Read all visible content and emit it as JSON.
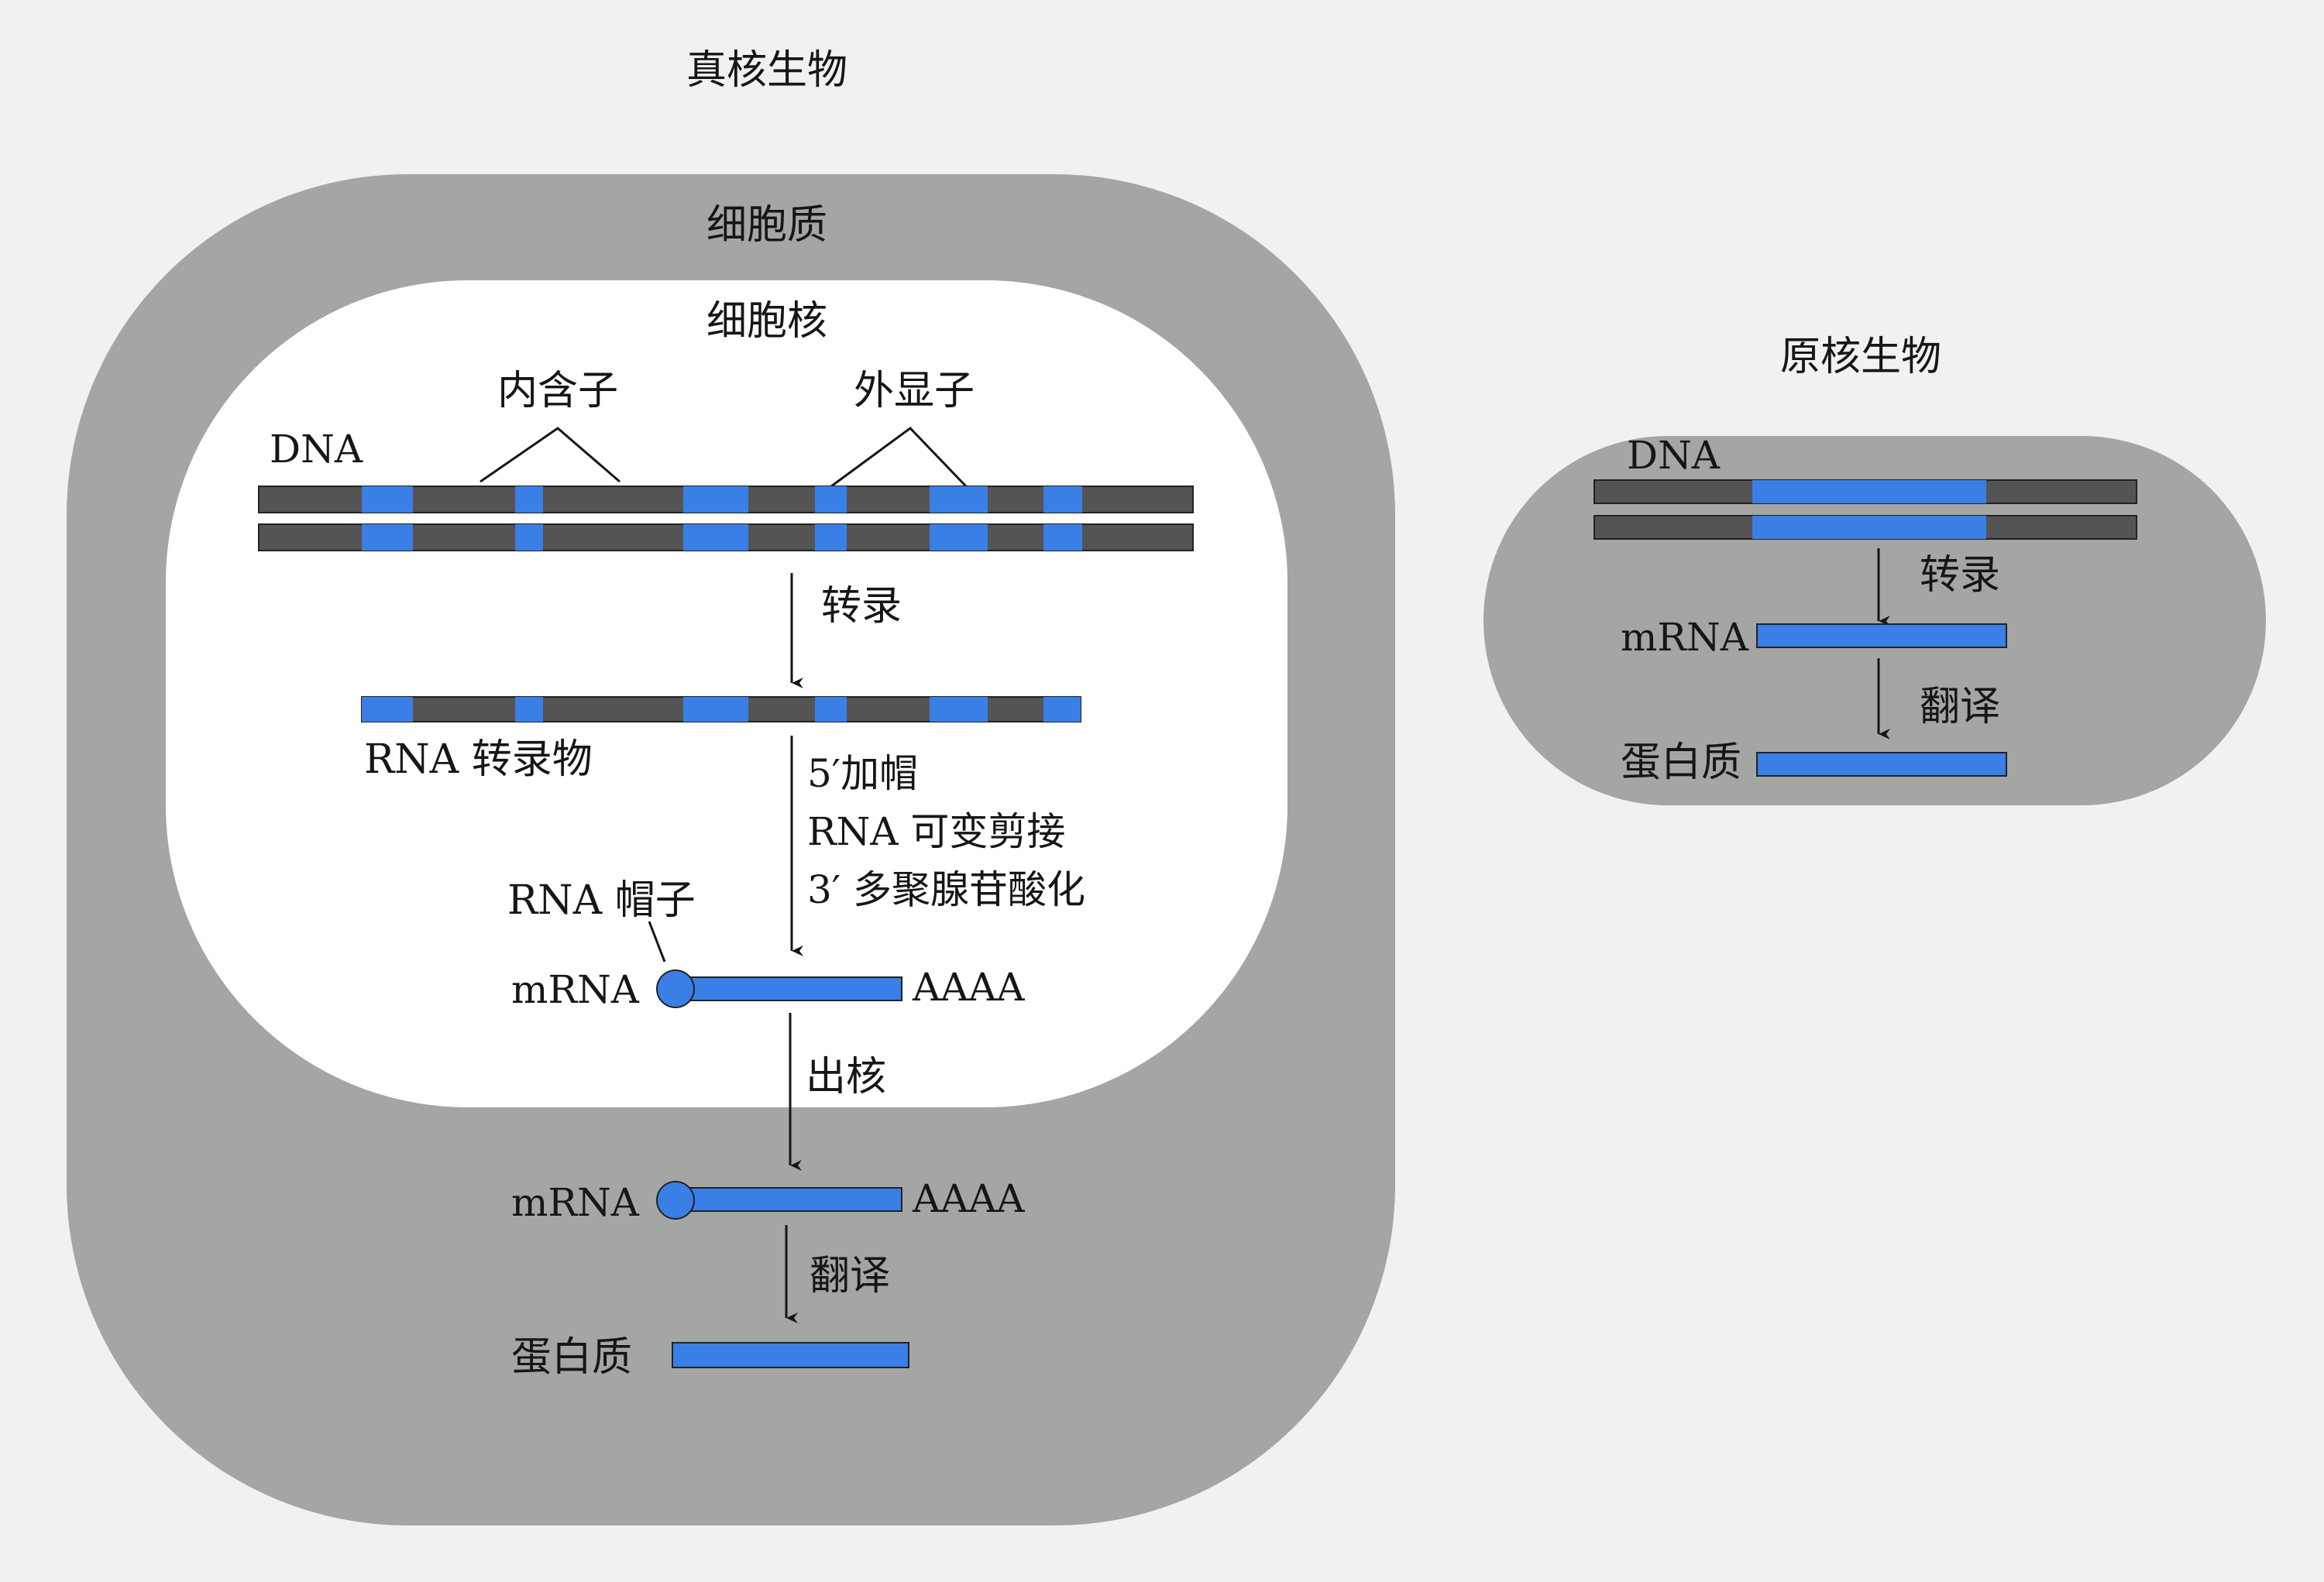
{
  "eukaryote": {
    "title": "真核生物",
    "cytoplasm_label": "细胞质",
    "nucleus_label": "细胞核",
    "intron_label": "内含子",
    "exon_label": "外显子",
    "dna_label": "DNA",
    "step_transcription": "转录",
    "rna_transcript_label": "RNA 转录物",
    "processing_steps": [
      "5′加帽",
      "RNA 可变剪接",
      "3′ 多聚腺苷酸化"
    ],
    "rna_cap_label": "RNA 帽子",
    "mrna_label": "mRNA",
    "polya_label": "AAAA",
    "step_export": "出核",
    "mrna2_label": "mRNA",
    "polya2_label": "AAAA",
    "step_translation": "翻译",
    "protein_label": "蛋白质"
  },
  "prokaryote": {
    "title": "原核生物",
    "dna_label": "DNA",
    "step_transcription": "转录",
    "mrna_label": "mRNA",
    "step_translation": "翻译",
    "protein_label": "蛋白质"
  },
  "colors": {
    "background": "#f1f1ef",
    "cell_body": "#a4a6a4",
    "nucleus": "#ffffff",
    "exon_blue": "#3a7fe6",
    "intron_gray": "#545454",
    "arrow": "#161616"
  }
}
